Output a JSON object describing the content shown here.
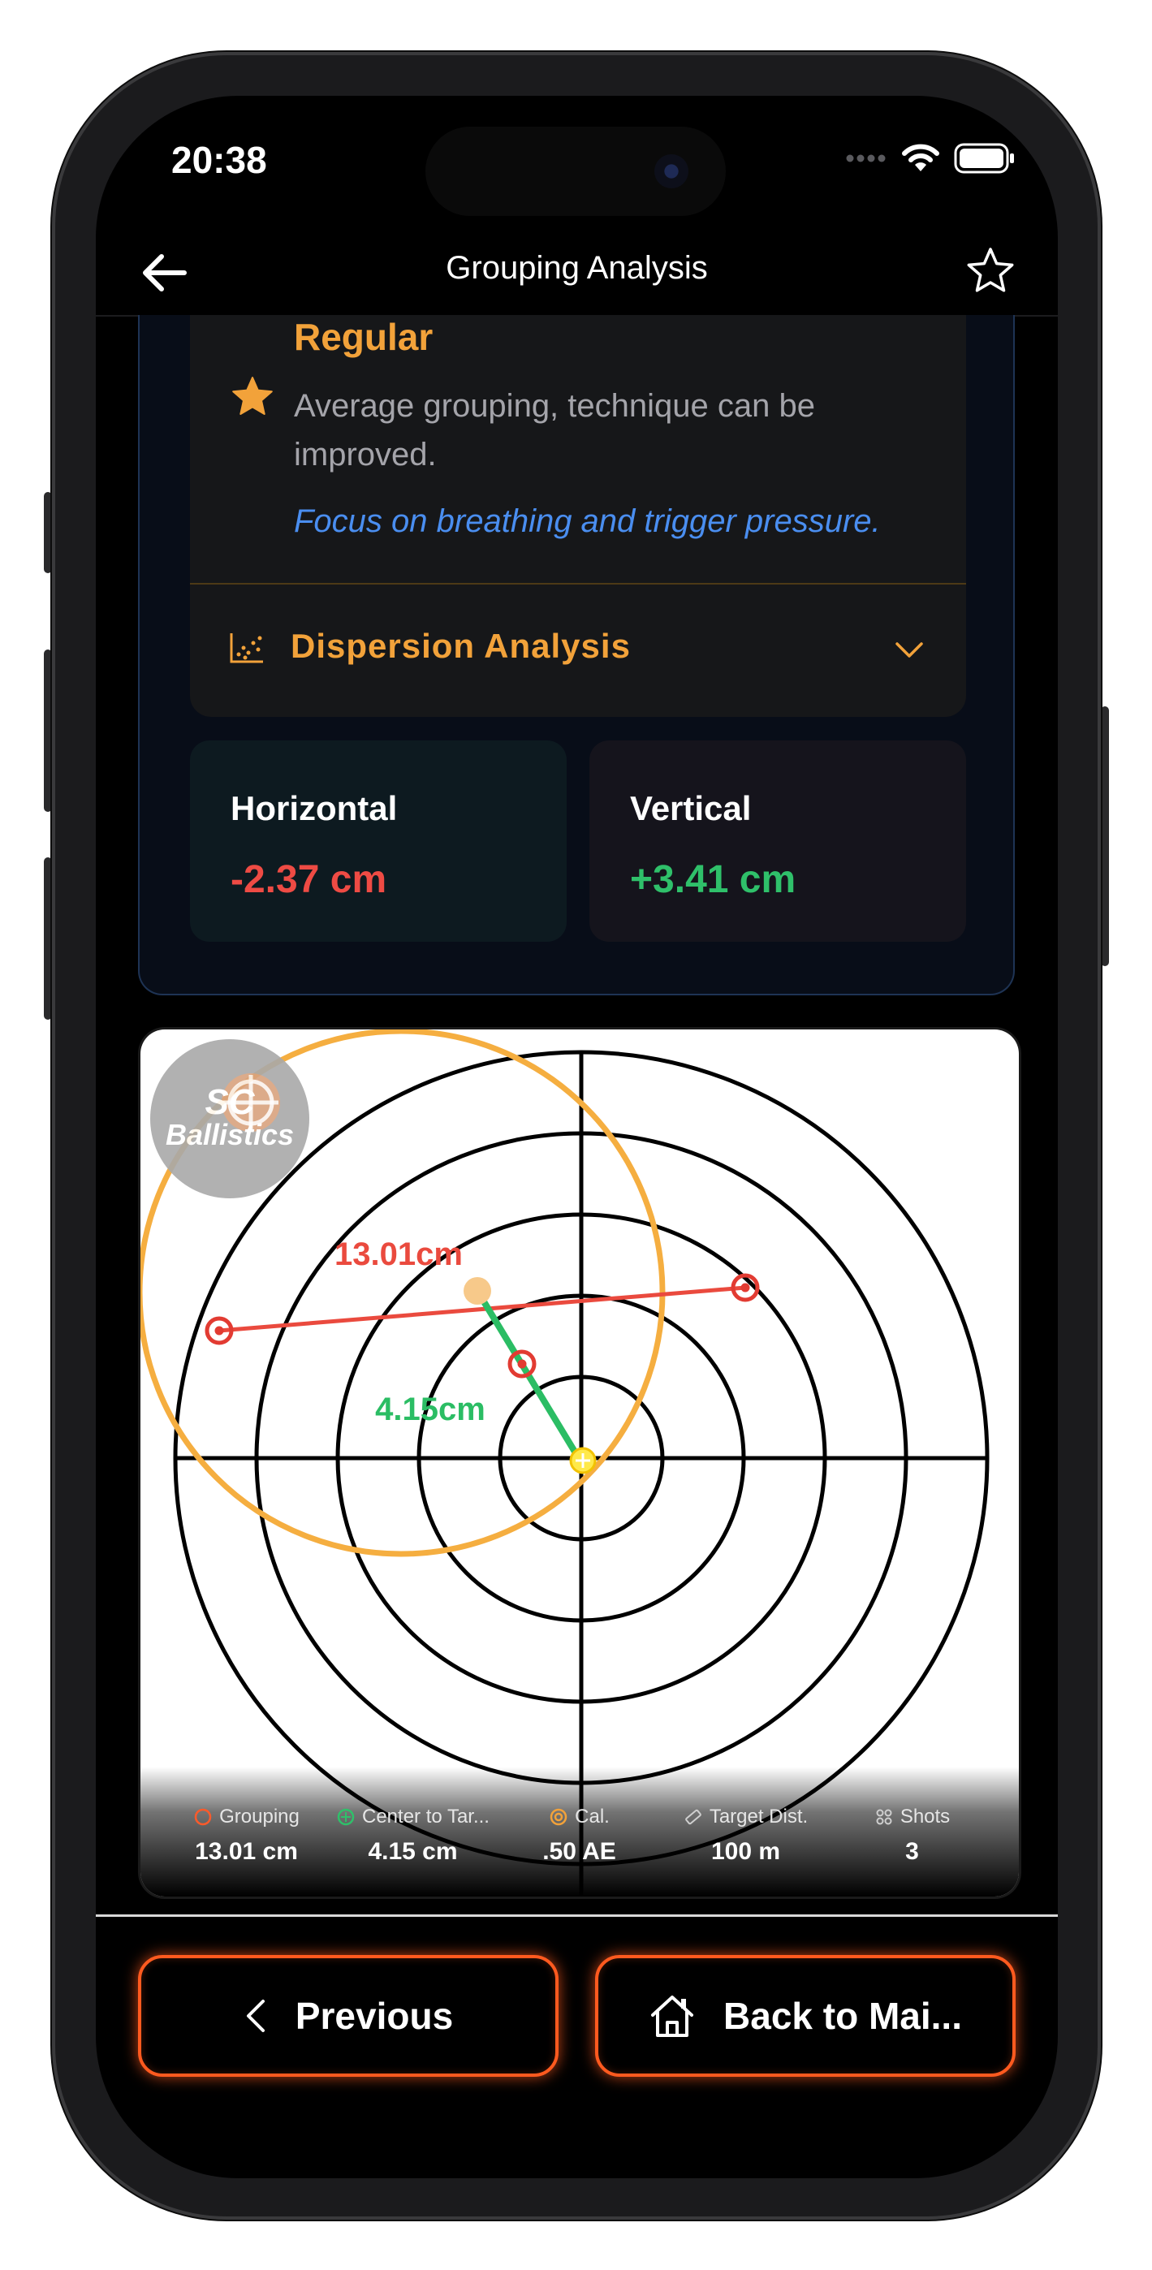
{
  "status_bar": {
    "time": "20:38"
  },
  "nav": {
    "title": "Grouping Analysis"
  },
  "rating": {
    "level": "Regular",
    "description": "Average grouping, technique can be improved.",
    "tip": "Focus on breathing and trigger pressure."
  },
  "dispersion": {
    "label": "Dispersion Analysis"
  },
  "stats": {
    "horizontal_label": "Horizontal",
    "horizontal_value": "-2.37 cm",
    "vertical_label": "Vertical",
    "vertical_value": "+3.41 cm"
  },
  "target": {
    "logo_line1": "SC",
    "logo_line2": "Ballistics",
    "group_size_label": "13.01cm",
    "center_distance_label": "4.15cm"
  },
  "legend": [
    {
      "label": "Grouping",
      "value": "13.01 cm",
      "icon": "ring-icon",
      "color": "#ff5a2a"
    },
    {
      "label": "Center to Tar...",
      "value": "4.15 cm",
      "icon": "crosshair-icon",
      "color": "#2fc06a"
    },
    {
      "label": "Cal.",
      "value": ".50 AE",
      "icon": "bullseye-icon",
      "color": "#f2a23a"
    },
    {
      "label": "Target Dist.",
      "value": "100 m",
      "icon": "ruler-icon",
      "color": "#cfcfcf"
    },
    {
      "label": "Shots",
      "value": "3",
      "icon": "grid-dots-icon",
      "color": "#cfcfcf"
    }
  ],
  "buttons": {
    "previous": "Previous",
    "home": "Back to Mai..."
  },
  "colors": {
    "accent": "#f2a23a",
    "danger": "#ee4b44",
    "success": "#2fc06a",
    "button_glow": "#ff5a1f",
    "link": "#4a8ef0"
  }
}
